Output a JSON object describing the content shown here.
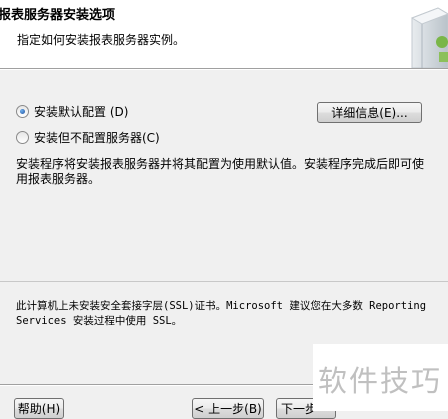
{
  "header": {
    "title": "报表服务器安装选项",
    "subtitle": "指定如何安装报表服务器实例。"
  },
  "options": [
    {
      "label": "安装默认配置 (D)",
      "selected": true
    },
    {
      "label": "安装但不配置服务器(C)",
      "selected": false
    }
  ],
  "details_button": "详细信息(E)...",
  "description": "安装程序将安装报表服务器并将其配置为使用默认值。安装程序完成后即可使用报表服务器。",
  "ssl_note": "此计算机上未安装安全套接字层(SSL)证书。Microsoft 建议您在大多数 Reporting Services 安装过程中使用 SSL。",
  "footer": {
    "help": "帮助(H)",
    "back": "< 上一步(B)",
    "next": "下一步"
  },
  "watermark": "软件技巧",
  "colors": {
    "accent_dot": "#1e4e9c",
    "header_bg": "#ffffff",
    "body_bg": "#f0f0f0"
  }
}
